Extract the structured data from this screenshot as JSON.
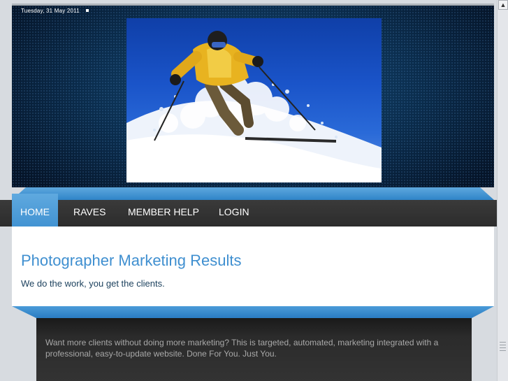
{
  "header": {
    "date": "Tuesday, 31 May 2011"
  },
  "nav": {
    "items": [
      {
        "label": "HOME",
        "active": true
      },
      {
        "label": "RAVES",
        "active": false
      },
      {
        "label": "MEMBER HELP",
        "active": false
      },
      {
        "label": "LOGIN",
        "active": false
      }
    ]
  },
  "intro": {
    "title": "Photographer Marketing Results",
    "subtitle": "We do the work, you get the clients."
  },
  "content": {
    "text": "Want more clients without doing more marketing? This is targeted, automated, marketing integrated with a professional, easy-to-update website. Done For You. Just You."
  },
  "colors": {
    "accent_blue": "#3f8fd0",
    "nav_dark": "#2c2c2c",
    "header_dark": "#0b2e4f"
  },
  "icons": {
    "scroll_up": "chevron-up-icon"
  }
}
